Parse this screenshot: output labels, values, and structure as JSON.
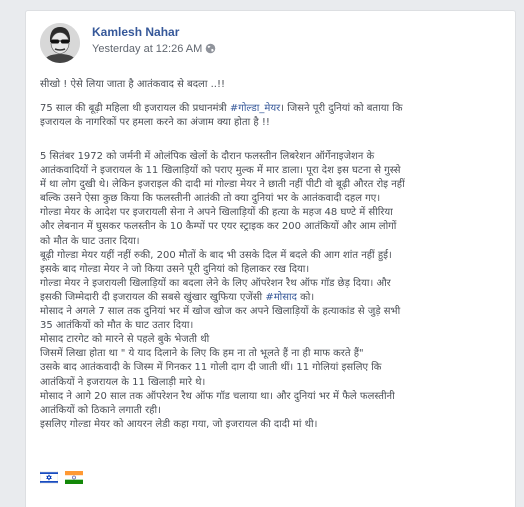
{
  "post": {
    "author": "Kamlesh Nahar",
    "timestamp": "Yesterday at 12:26 AM",
    "privacy_icon": "globe-icon",
    "intro": "सीखो ! ऐसे लिया जाता है आतंकवाद से बदला ..!!",
    "para2_lines": [
      [
        {
          "t": "75 साल की बूढ़ी महिला थी इजरायल की प्रधानमंत्री "
        },
        {
          "t": "#गोल्डा_मेयर",
          "tag": true
        },
        {
          "t": "। जिसने पूरी दुनियां को बताया कि"
        }
      ],
      [
        {
          "t": "इजरायल के नागरिकों पर हमला करने का अंजाम क्या होता है !!"
        }
      ]
    ],
    "body_lines": [
      [
        {
          "t": "5 सितंबर 1972 को जर्मनी में ओलंपिक खेलों के दौरान फलस्तीन लिबरेशन ऑर्गेनाइजेशन के"
        }
      ],
      [
        {
          "t": "आतंकवादियों ने इजरायल के 11 खिलाड़ियों को पराए मुल्क में मार डाला। पूरा देश इस घटना से गुस्से"
        }
      ],
      [
        {
          "t": "में था लोग दुखी थे। लेकिन इजराइल की दादी मां गोल्डा मेयर ने छाती नहीं पीटी वो बूढ़ी औरत रोइ नहीं"
        }
      ],
      [
        {
          "t": "बल्कि उसने ऐसा कुछ किया कि फलस्तीनी आतंकी तो क्या दुनियां भर के आतंकवादी दहल गए।"
        }
      ],
      [
        {
          "t": "गोल्डा मेयर के आदेश पर इजरायली सेना ने अपने खिलाड़ियों की हत्या के महज 48 घण्टे में सीरिया"
        }
      ],
      [
        {
          "t": "और लेबनान में घुसकर फलस्तीन के 10 कैम्पों पर एयर स्ट्राइक कर 200 आतंकियों और आम लोगों"
        }
      ],
      [
        {
          "t": "को मौत के घाट उतार दिया।"
        }
      ],
      [
        {
          "t": "बूढ़ी गोल्डा मेयर यहीं नहीं रुकी, 200 मौतों के बाद भी उसके दिल में बदले की आग शांत नहीं हुई।"
        }
      ],
      [
        {
          "t": "इसके बाद गोल्डा मेयर ने जो किया उसने पूरी दुनियां को हिलाकर रख दिया।"
        }
      ],
      [
        {
          "t": "गोल्डा मेयर ने इजरायली खिलाड़ियों का बदला लेने के लिए ऑपरेशन रैथ ऑफ गॉड छेड़ दिया। और"
        }
      ],
      [
        {
          "t": "इसकी जिम्मेदारी दी इजरायल की सबसे खुंखार खुफिया एजेंसी "
        },
        {
          "t": "#मोसाद",
          "tag": true
        },
        {
          "t": " को।"
        }
      ],
      [
        {
          "t": "मोसाद ने अगले 7 साल तक दुनियां भर में खोज खोज कर अपने खिलाड़ियों के हत्याकांड से जुड़े सभी"
        }
      ],
      [
        {
          "t": "35 आतंकियों को मौत के घाट उतार दिया।"
        }
      ],
      [
        {
          "t": "मोसाद टारगेट को मारने से पहले बुके भेजती थी"
        }
      ],
      [
        {
          "t": "जिसमें लिखा होता था \" ये याद दिलाने के लिए कि हम ना तो भूलते हैं ना ही माफ करते हैं\""
        }
      ],
      [
        {
          "t": "उसके बाद आतंकवादी के जिस्म में गिनकर 11 गोली दाग दी जाती थीं। 11 गोलियां इसलिए कि"
        }
      ],
      [
        {
          "t": "आतंकियों ने इजरायल के 11 खिलाड़ी मारे थे।"
        }
      ],
      [
        {
          "t": "मोसाद ने आगे 20 साल तक ऑपरेशन रैथ ऑफ गॉड चलाया था। और दुनियां भर में फैले फलस्तीनी"
        }
      ],
      [
        {
          "t": "आतंकियों को ठिकाने लगाती रही।"
        }
      ],
      [
        {
          "t": "इसलिए गोल्डा मेयर को आयरन लेडी कहा गया, जो इजरायल की दादी मां थी।"
        }
      ]
    ],
    "flags": [
      "israel-flag-icon",
      "india-flag-icon"
    ]
  },
  "colors": {
    "link": "#365899",
    "text": "#4b4f56",
    "israel_blue": "#0038b8",
    "india_saffron": "#ff9933",
    "india_green": "#138808",
    "chakra": "#000080"
  }
}
